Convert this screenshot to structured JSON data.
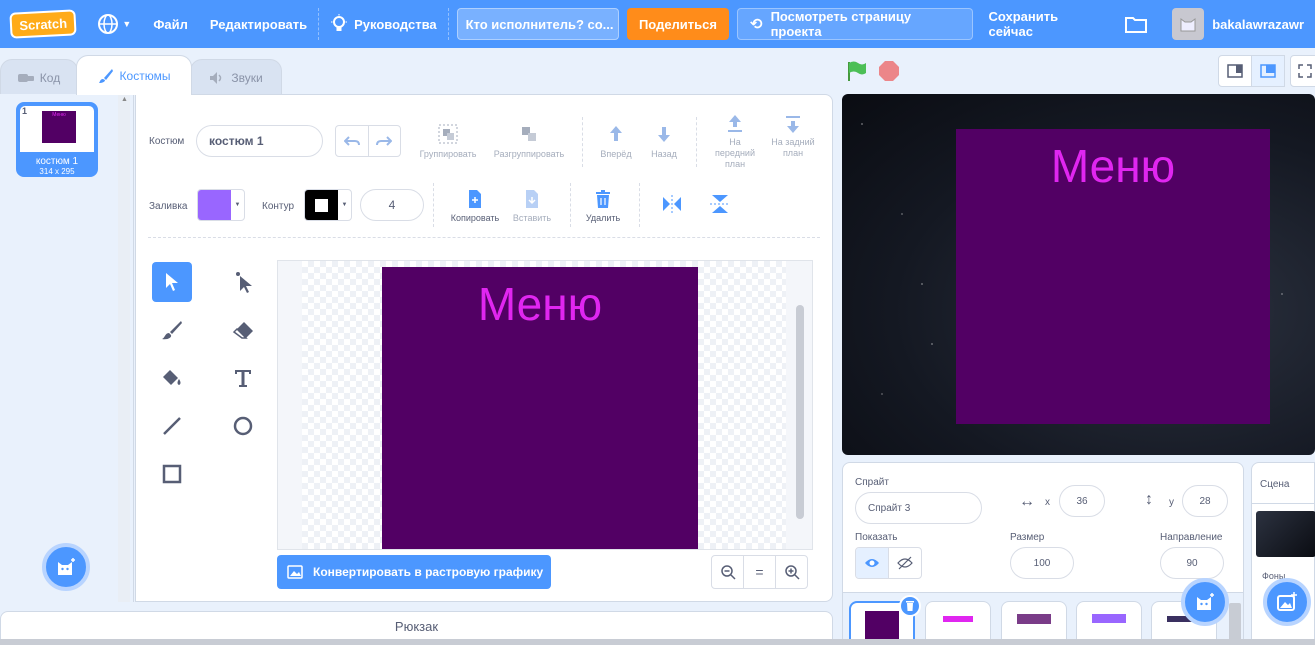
{
  "menubar": {
    "logo": "Scratch",
    "file": "Файл",
    "edit": "Редактировать",
    "tutorials": "Руководства",
    "project_title": "Кто исполнитель? со...",
    "share": "Поделиться",
    "see_project_page": "Посмотреть страницу проекта",
    "save_now": "Сохранить сейчас",
    "username": "bakalawrazawr"
  },
  "tabs": {
    "code": "Код",
    "costumes": "Костюмы",
    "sounds": "Звуки"
  },
  "costumes": [
    {
      "index": "1",
      "name": "костюм 1",
      "size": "314 x 295",
      "thumb_text": "Меню"
    }
  ],
  "editor": {
    "costume_label": "Костюм",
    "costume_name": "костюм 1",
    "group": "Группировать",
    "ungroup": "Разгруппировать",
    "forward": "Вперёд",
    "backward": "Назад",
    "front": "На передний план",
    "back": "На задний план",
    "fill_label": "Заливка",
    "outline_label": "Контур",
    "outline_width": "4",
    "copy": "Копировать",
    "paste": "Вставить",
    "delete": "Удалить",
    "canvas_text": "Меню",
    "convert": "Конвертировать в растровую графику",
    "zoom_reset": "="
  },
  "backpack": "Рюкзак",
  "stage": {
    "text": "Меню"
  },
  "sprite_info": {
    "sprite_label": "Спрайт",
    "sprite_name": "Спрайт 3",
    "x_label": "x",
    "x_value": "36",
    "y_label": "y",
    "y_value": "28",
    "show_label": "Показать",
    "size_label": "Размер",
    "size_value": "100",
    "direction_label": "Направление",
    "direction_value": "90"
  },
  "stage_panel": {
    "title": "Сцена",
    "backdrops": "Фоны"
  },
  "colors": {
    "accent": "#4c97ff",
    "share": "#ff8c1a",
    "costume_bg": "#520064",
    "costume_text": "#e026f0",
    "fill": "#9966ff",
    "outline": "#000000"
  }
}
